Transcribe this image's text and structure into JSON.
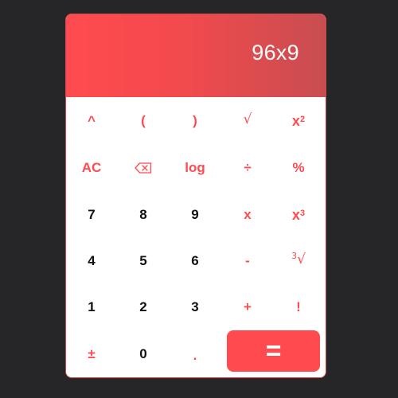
{
  "display": {
    "expression": "96x9"
  },
  "keys": {
    "caret": "^",
    "open_paren": "(",
    "close_paren": ")",
    "sqrt": "√",
    "square_base": "x",
    "square_exp": "2",
    "ac": "AC",
    "log": "log",
    "divide": "÷",
    "percent": "%",
    "seven": "7",
    "eight": "8",
    "nine": "9",
    "multiply": "x",
    "cube_base": "x",
    "cube_exp": "3",
    "four": "4",
    "five": "5",
    "six": "6",
    "minus": "-",
    "cbrt_index": "3",
    "cbrt_sign": "√",
    "one": "1",
    "two": "2",
    "three": "3",
    "plus": "+",
    "factorial": "!",
    "plus_minus": "±",
    "zero": "0",
    "decimal": ".",
    "equals": "="
  },
  "icons": {
    "backspace": "backspace-icon"
  },
  "colors": {
    "accent": "#ff4b4f",
    "background": "#262628",
    "digit": "#111111",
    "panel": "#ffffff"
  }
}
